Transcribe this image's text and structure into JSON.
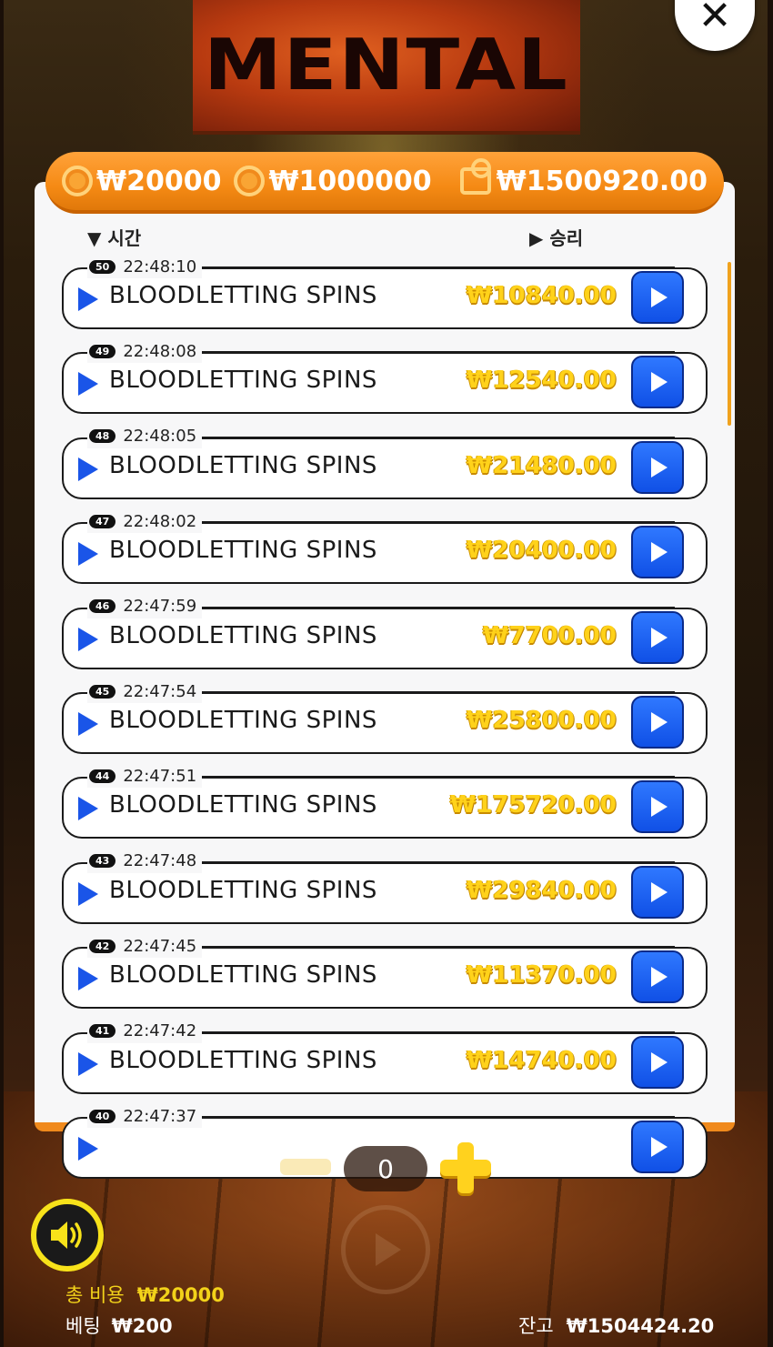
{
  "logo": {
    "text": "MENTAL"
  },
  "header": {
    "min_bet": "₩20000",
    "max_bet": "₩1000000",
    "balance": "₩1500920.00"
  },
  "columns": {
    "time": "시간",
    "win": "승리"
  },
  "rows": [
    {
      "num": "50",
      "time": "22:48:10",
      "label": "BLOODLETTING SPINS",
      "win": "₩10840.00"
    },
    {
      "num": "49",
      "time": "22:48:08",
      "label": "BLOODLETTING SPINS",
      "win": "₩12540.00"
    },
    {
      "num": "48",
      "time": "22:48:05",
      "label": "BLOODLETTING SPINS",
      "win": "₩21480.00"
    },
    {
      "num": "47",
      "time": "22:48:02",
      "label": "BLOODLETTING SPINS",
      "win": "₩20400.00"
    },
    {
      "num": "46",
      "time": "22:47:59",
      "label": "BLOODLETTING SPINS",
      "win": "₩7700.00"
    },
    {
      "num": "45",
      "time": "22:47:54",
      "label": "BLOODLETTING SPINS",
      "win": "₩25800.00"
    },
    {
      "num": "44",
      "time": "22:47:51",
      "label": "BLOODLETTING SPINS",
      "win": "₩175720.00"
    },
    {
      "num": "43",
      "time": "22:47:48",
      "label": "BLOODLETTING SPINS",
      "win": "₩29840.00"
    },
    {
      "num": "42",
      "time": "22:47:45",
      "label": "BLOODLETTING SPINS",
      "win": "₩11370.00"
    },
    {
      "num": "41",
      "time": "22:47:42",
      "label": "BLOODLETTING SPINS",
      "win": "₩14740.00"
    },
    {
      "num": "40",
      "time": "22:47:37",
      "label": "",
      "win": ""
    }
  ],
  "controls": {
    "quantity": "0"
  },
  "footer": {
    "cost_label": "총 비용",
    "cost_value": "₩20000",
    "bet_label": "베팅",
    "bet_value": "₩200",
    "balance_label": "잔고",
    "balance_value": "₩1504424.20"
  },
  "icons": {
    "close": "close-icon",
    "sound": "speaker-icon",
    "row_play": "play-icon",
    "coin": "coin-icon",
    "wallet": "wallet-icon"
  },
  "colors": {
    "accent_orange": "#f58a14",
    "win_gold": "#ffd21a",
    "play_blue": "#1a55e8",
    "sound_yellow": "#f7e21a"
  }
}
